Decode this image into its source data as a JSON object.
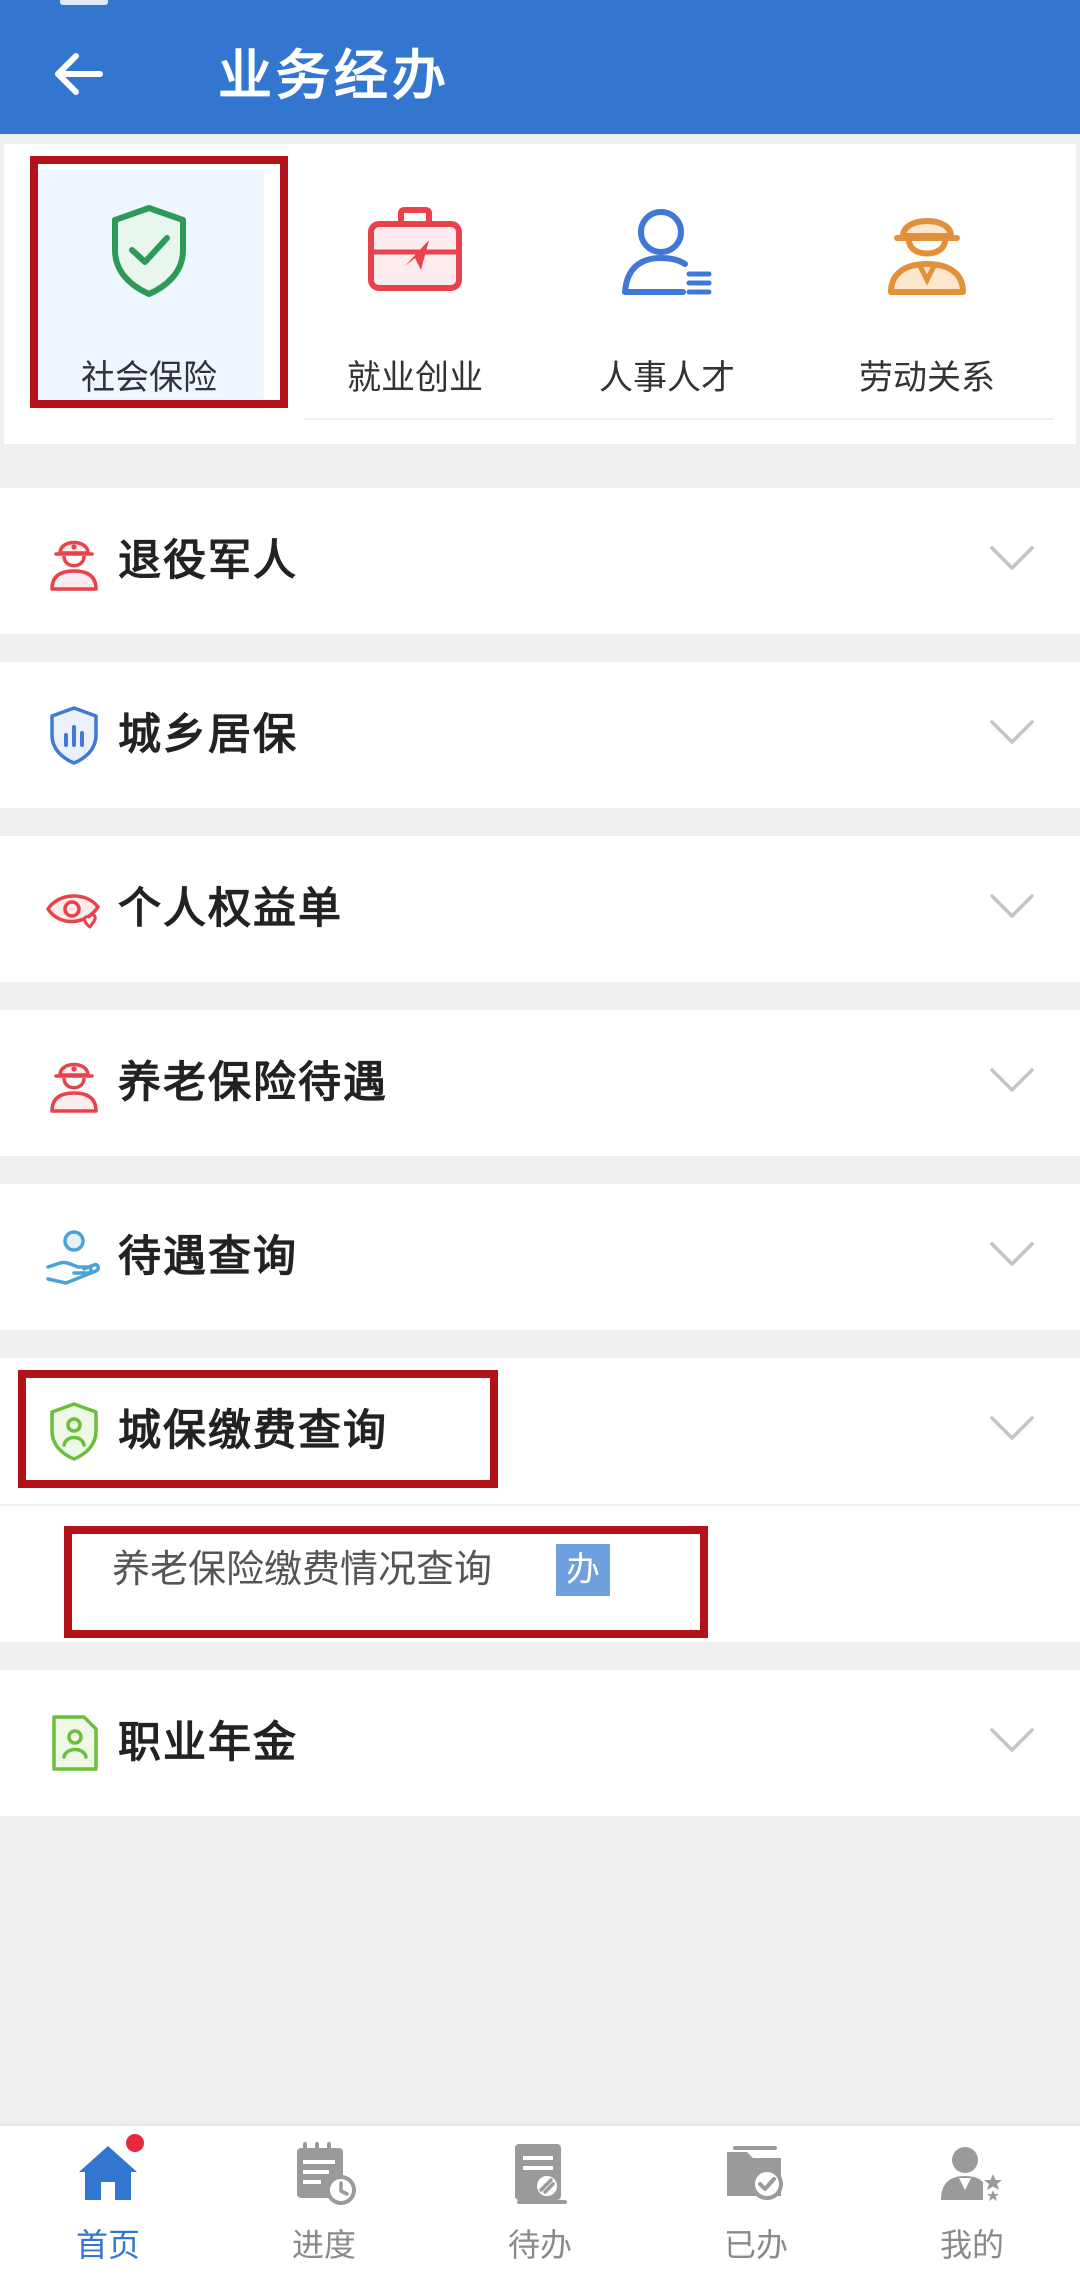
{
  "header": {
    "title": "业务经办",
    "back_icon": "arrow-left-icon",
    "background_color": "#3276cf"
  },
  "categories": [
    {
      "label": "社会保险",
      "icon": "shield-check-icon",
      "active": true,
      "color": "#2e9a57"
    },
    {
      "label": "就业创业",
      "icon": "briefcase-icon",
      "active": false,
      "color": "#e8424a"
    },
    {
      "label": "人事人才",
      "icon": "person-list-icon",
      "active": false,
      "color": "#3f78d6"
    },
    {
      "label": "劳动关系",
      "icon": "worker-helmet-icon",
      "active": false,
      "color": "#e3903a"
    }
  ],
  "sections": [
    {
      "label": "退役军人",
      "icon": "veteran-icon",
      "expanded": false
    },
    {
      "label": "城乡居保",
      "icon": "shield-chart-icon",
      "expanded": false
    },
    {
      "label": "个人权益单",
      "icon": "eye-heart-icon",
      "expanded": false
    },
    {
      "label": "养老保险待遇",
      "icon": "veteran-icon",
      "expanded": false
    },
    {
      "label": "待遇查询",
      "icon": "hand-person-icon",
      "expanded": false
    },
    {
      "label": "城保缴费查询",
      "icon": "shield-person-icon",
      "expanded": true,
      "sub_items": [
        {
          "label": "养老保险缴费情况查询",
          "badge": "办"
        }
      ]
    },
    {
      "label": "职业年金",
      "icon": "document-person-icon",
      "expanded": false
    }
  ],
  "tabbar": {
    "items": [
      {
        "label": "首页",
        "icon": "home-icon",
        "active": true,
        "has_dot": true
      },
      {
        "label": "进度",
        "icon": "calendar-clock-icon",
        "active": false
      },
      {
        "label": "待办",
        "icon": "todo-list-icon",
        "active": false
      },
      {
        "label": "已办",
        "icon": "done-folder-icon",
        "active": false
      },
      {
        "label": "我的",
        "icon": "user-star-icon",
        "active": false
      }
    ],
    "active_color": "#3276cf",
    "inactive_color": "#8a8a8a"
  },
  "highlight_color": "#b3121a"
}
